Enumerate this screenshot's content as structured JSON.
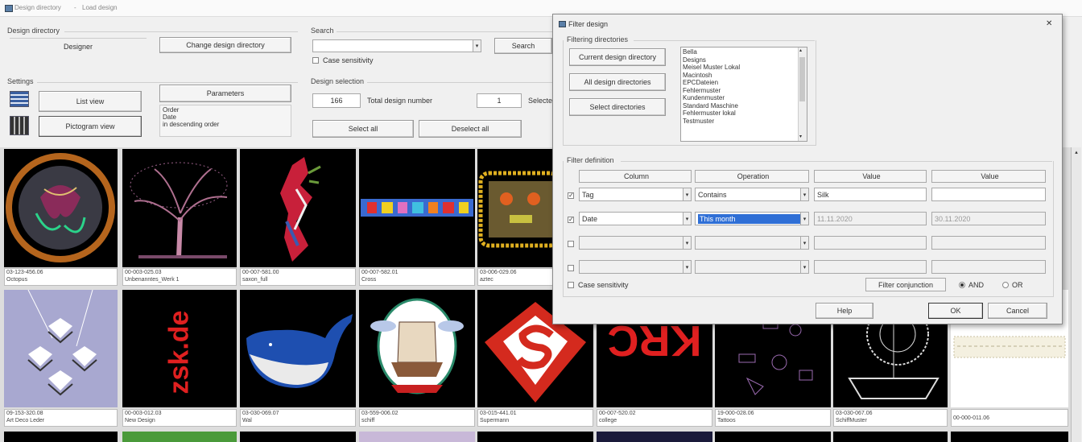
{
  "title_bar": {
    "app": "Design directory",
    "sep": "-",
    "window": "Load design"
  },
  "design_directory": {
    "legend": "Design directory",
    "current": "Designer",
    "change_button": "Change design directory"
  },
  "search": {
    "legend": "Search",
    "value": "",
    "button": "Search",
    "case_sensitivity": "Case sensitivity"
  },
  "settings": {
    "legend": "Settings",
    "list_view": "List view",
    "pictogram_view": "Pictogram view",
    "parameters": "Parameters",
    "order_lines": [
      "Order",
      "Date",
      "in descending order"
    ]
  },
  "design_selection": {
    "legend": "Design selection",
    "count": "166",
    "count_label": "Total design number",
    "selected": "1",
    "selected_label": "Selected",
    "select_all": "Select all",
    "deselect_all": "Deselect all"
  },
  "designs": [
    {
      "number": "03-123-456.06",
      "name": "Octopus"
    },
    {
      "number": "00-003-025.03",
      "name": "Unbenanntes_Werk 1"
    },
    {
      "number": "00-007-581.00",
      "name": "saxon_full"
    },
    {
      "number": "00-007-582.01",
      "name": "Cross"
    },
    {
      "number": "03-006-029.06",
      "name": "aztec"
    },
    {
      "number": "09-153-320.08",
      "name": "Art Deco Leder"
    },
    {
      "number": "00-003-012.03",
      "name": "New Design"
    },
    {
      "number": "03-030-069.07",
      "name": "Wal"
    },
    {
      "number": "03-559-006.02",
      "name": "schiff"
    },
    {
      "number": "03-015-441.01",
      "name": "Supermann"
    },
    {
      "number": "00-007-520.02",
      "name": "college"
    },
    {
      "number": "19-000-028.06",
      "name": "Tattoos"
    },
    {
      "number": "03-030-067.06",
      "name": "SchiffMuster"
    },
    {
      "number": "00-000-011.06",
      "name": ""
    }
  ],
  "thumb_texts": {
    "zsk": "zsk.de",
    "krc": "KRC"
  },
  "dialog": {
    "title": "Filter design",
    "close": "✕",
    "filtering_directories": {
      "legend": "Filtering directories",
      "current_button": "Current design directory",
      "all_button": "All design directories",
      "select_button": "Select directories",
      "directories": [
        "Bella",
        "Designs",
        "Meisel Muster Lokal",
        "Macintosh",
        "EPCDateien",
        "Fehlermuster",
        "Kundenmuster",
        "Standard Maschine",
        "Fehlermuster lokal",
        "Testmuster"
      ]
    },
    "filter_definition": {
      "legend": "Filter definition",
      "headers": [
        "Column",
        "Operation",
        "Value",
        "Value"
      ],
      "rows": [
        {
          "checked": true,
          "column": "Tag",
          "operation": "Contains",
          "value1": "Silk",
          "value2": ""
        },
        {
          "checked": true,
          "column": "Date",
          "operation": "This month",
          "value1": "11.11.2020",
          "value2": "30.11.2020"
        },
        {
          "checked": false,
          "column": "",
          "operation": "",
          "value1": "",
          "value2": ""
        },
        {
          "checked": false,
          "column": "",
          "operation": "",
          "value1": "",
          "value2": ""
        }
      ],
      "case_sensitivity": "Case sensitivity",
      "filter_conjunction": "Filter conjunction",
      "and": "AND",
      "or": "OR"
    },
    "help_button": "Help",
    "ok_button": "OK",
    "cancel_button": "Cancel"
  }
}
